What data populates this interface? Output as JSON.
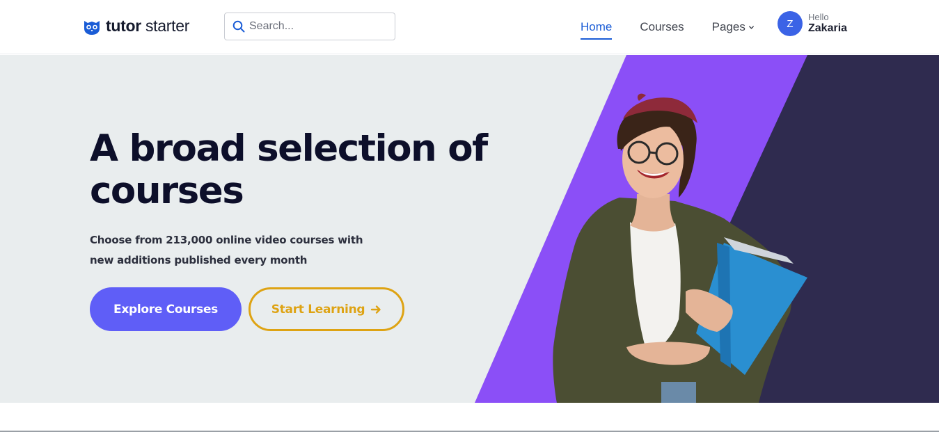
{
  "header": {
    "logo": {
      "bold": "tutor",
      "regular": " starter",
      "icon": "owl-logo-icon"
    },
    "search": {
      "placeholder": "Search...",
      "icon": "search-icon"
    },
    "nav": {
      "home": "Home",
      "courses": "Courses",
      "pages": "Pages"
    },
    "user": {
      "initial": "Z",
      "greeting": "Hello",
      "name": "Zakaria"
    }
  },
  "hero": {
    "title": "A broad selection of courses",
    "subtitle": "Choose from 213,000 online video courses with new additions published every month",
    "explore_button": "Explore Courses",
    "start_button": "Start Learning"
  },
  "colors": {
    "accent": "#1a5cd6",
    "button_primary": "#5f5ef7",
    "button_outline": "#dea313",
    "purple_band": "#8b4ff7",
    "dark_band": "#2f2b4f",
    "hero_bg": "#e9edee"
  }
}
